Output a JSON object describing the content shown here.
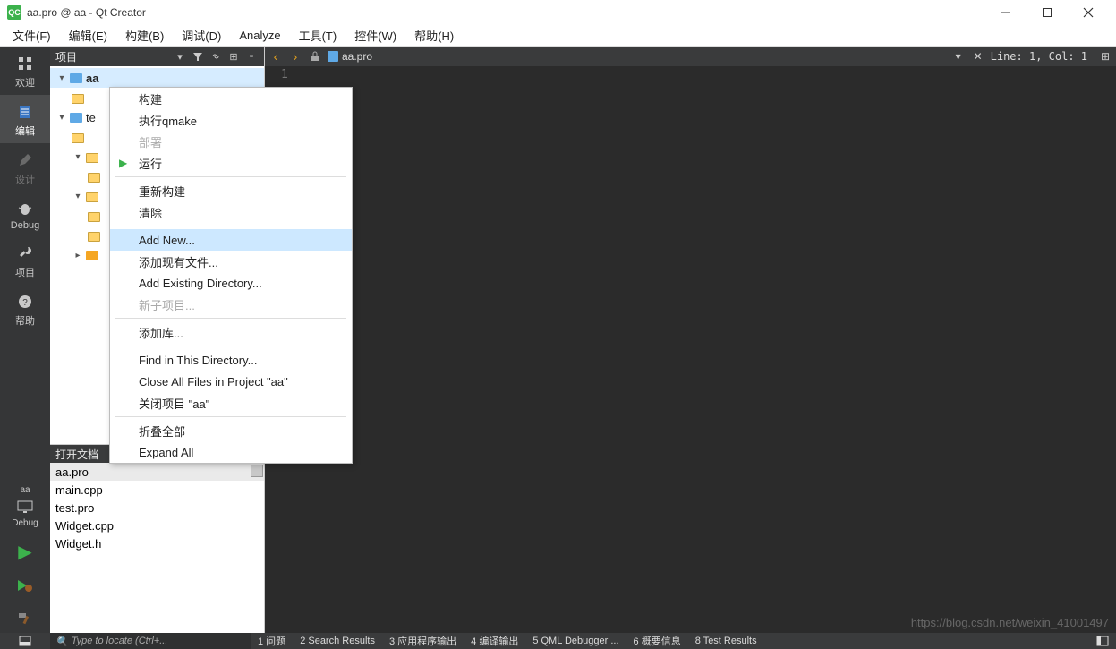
{
  "window": {
    "title": "aa.pro @ aa - Qt Creator"
  },
  "menubar": [
    "文件(F)",
    "编辑(E)",
    "构建(B)",
    "调试(D)",
    "Analyze",
    "工具(T)",
    "控件(W)",
    "帮助(H)"
  ],
  "rail": {
    "welcome": "欢迎",
    "edit": "编辑",
    "design": "设计",
    "debug": "Debug",
    "projects": "项目",
    "help": "帮助",
    "target_aa": "aa",
    "target_debug": "Debug"
  },
  "project_panel": {
    "header": "项目",
    "tree": {
      "aa": "aa",
      "te": "te",
      "indent_a": "",
      "indent_b": ""
    }
  },
  "open_docs": {
    "header": "打开文档",
    "items": [
      "aa.pro",
      "main.cpp",
      "test.pro",
      "Widget.cpp",
      "Widget.h"
    ]
  },
  "editor": {
    "file": "aa.pro",
    "status": "Line: 1, Col: 1",
    "gutter_line": "1"
  },
  "context_menu": {
    "build": "构建",
    "qmake": "执行qmake",
    "deploy": "部署",
    "run": "运行",
    "rebuild": "重新构建",
    "clean": "清除",
    "add_new": "Add New...",
    "add_existing": "添加现有文件...",
    "add_existing_dir": "Add Existing Directory...",
    "new_sub": "新子项目...",
    "add_lib": "添加库...",
    "find_in_dir": "Find in This Directory...",
    "close_all_files": "Close All Files in Project \"aa\"",
    "close_project": "关闭项目 \"aa\"",
    "collapse_all": "折叠全部",
    "expand_all": "Expand All"
  },
  "bottombar": {
    "search": "Type to locate (Ctrl+...",
    "items": [
      "1 问题",
      "2 Search Results",
      "3 应用程序输出",
      "4 编译输出",
      "5 QML Debugger ...",
      "6 概要信息",
      "8 Test Results"
    ]
  },
  "watermark": "https://blog.csdn.net/weixin_41001497"
}
